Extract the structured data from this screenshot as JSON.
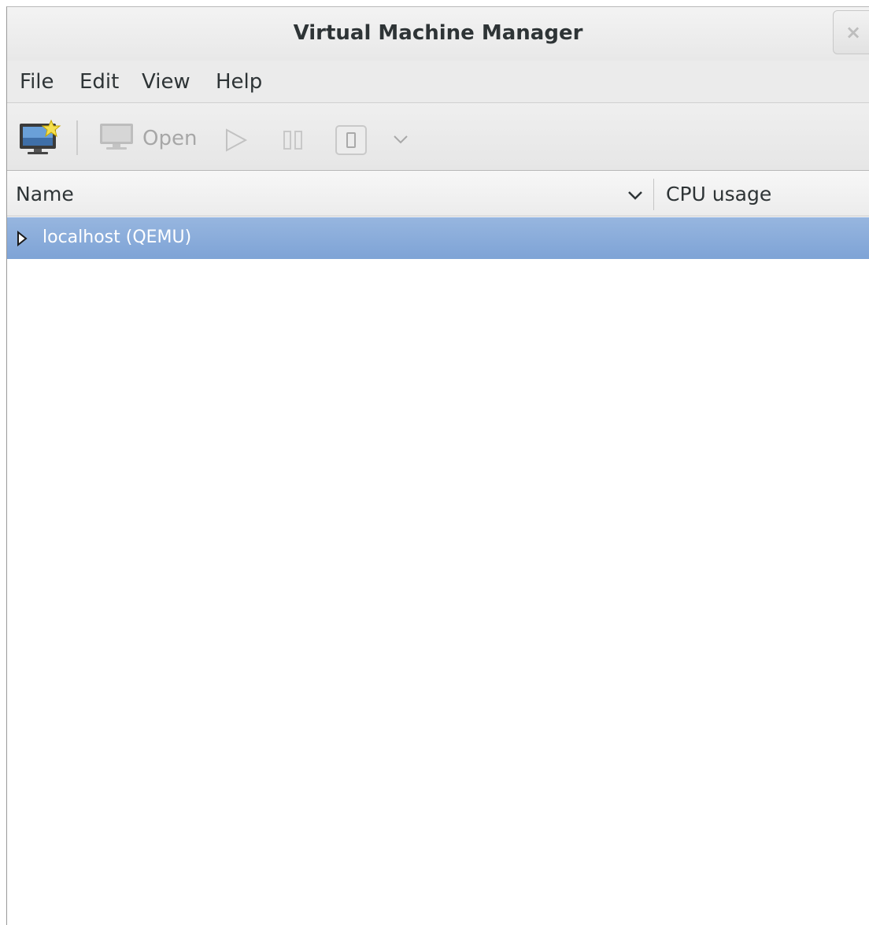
{
  "window": {
    "title": "Virtual Machine Manager",
    "close_glyph": "×"
  },
  "menubar": {
    "items": [
      {
        "label": "File"
      },
      {
        "label": "Edit"
      },
      {
        "label": "View"
      },
      {
        "label": "Help"
      }
    ]
  },
  "toolbar": {
    "new_vm_icon": "new-vm-monitor-star-icon",
    "open_label": "Open",
    "open_icon": "monitor-icon",
    "run_icon": "play-icon",
    "pause_icon": "pause-icon",
    "shutdown_icon": "shutdown-icon",
    "shutdown_menu_icon": "chevron-down-icon"
  },
  "columns": {
    "name": "Name",
    "cpu_usage": "CPU usage",
    "sort_icon": "chevron-down-icon"
  },
  "connections": [
    {
      "label": "localhost (QEMU)",
      "expanded": false,
      "selected": true
    }
  ],
  "colors": {
    "selection": "#86a9d9",
    "disabled_icon": "#b5b5b5"
  }
}
